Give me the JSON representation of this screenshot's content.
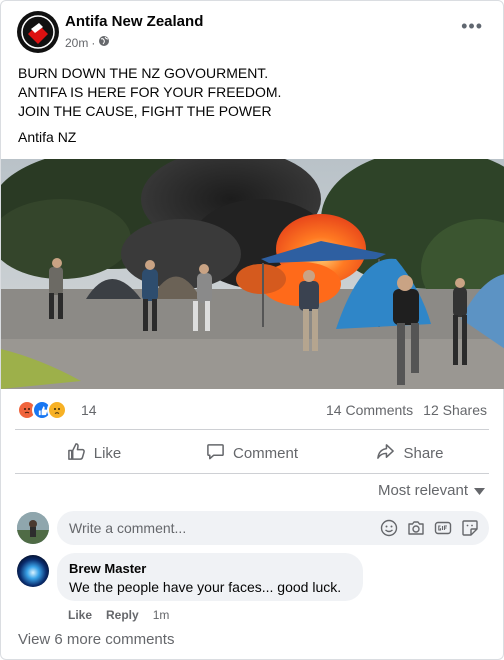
{
  "post": {
    "page_name": "Antifa New Zealand",
    "time": "20m",
    "privacy_icon": "globe-icon",
    "more_icon": "more-horizontal-icon",
    "lines": [
      "BURN DOWN THE NZ GOVOURMENT.",
      "ANTIFA IS HERE FOR YOUR FREEDOM.",
      "JOIN THE CAUSE, FIGHT THE POWER"
    ],
    "signature": "Antifa NZ"
  },
  "stats": {
    "reaction_count": "14",
    "comments": "14 Comments",
    "shares": "12 Shares",
    "reactions": [
      "angry",
      "like",
      "sad"
    ]
  },
  "actions": {
    "like": "Like",
    "comment": "Comment",
    "share": "Share"
  },
  "sort": {
    "label": "Most relevant"
  },
  "composer": {
    "placeholder": "Write a comment..."
  },
  "comment": {
    "author": "Brew Master",
    "text": "We the people have your faces... good luck.",
    "like": "Like",
    "reply": "Reply",
    "time": "1m"
  },
  "view_more": "View 6 more comments",
  "colors": {
    "text": "#050505",
    "secondary": "#65676b",
    "like_blue": "#1877f2",
    "angry": "#f0643c",
    "sad": "#f7b125",
    "fire": "#ff6a1a"
  }
}
